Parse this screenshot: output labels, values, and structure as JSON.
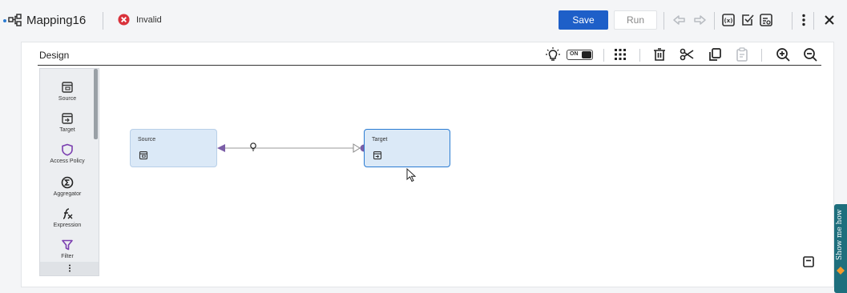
{
  "header": {
    "mapping_title": "Mapping16",
    "status_text": "Invalid",
    "save_label": "Save",
    "run_label": "Run"
  },
  "canvas": {
    "design_label": "Design",
    "validation_toggle_label": "ON",
    "validation_toggle_on": true
  },
  "palette": {
    "items": [
      {
        "label": "Source",
        "icon": "source-icon"
      },
      {
        "label": "Target",
        "icon": "target-icon"
      },
      {
        "label": "Access Policy",
        "icon": "shield-icon"
      },
      {
        "label": "Aggregator",
        "icon": "sigma-icon"
      },
      {
        "label": "Expression",
        "icon": "expression-icon"
      },
      {
        "label": "Filter",
        "icon": "filter-icon"
      }
    ]
  },
  "nodes": [
    {
      "label": "Source",
      "icon": "source-icon"
    },
    {
      "label": "Target",
      "icon": "target-icon"
    }
  ],
  "show_me_how": {
    "label": "Show me how"
  },
  "colors": {
    "accent": "#1e5fc8",
    "selected_border": "#2b7cd3",
    "node_fill": "#dbe9f7",
    "port": "#7b5ea7",
    "invalid": "#d9323b",
    "help_tab": "#1e6f7d"
  }
}
